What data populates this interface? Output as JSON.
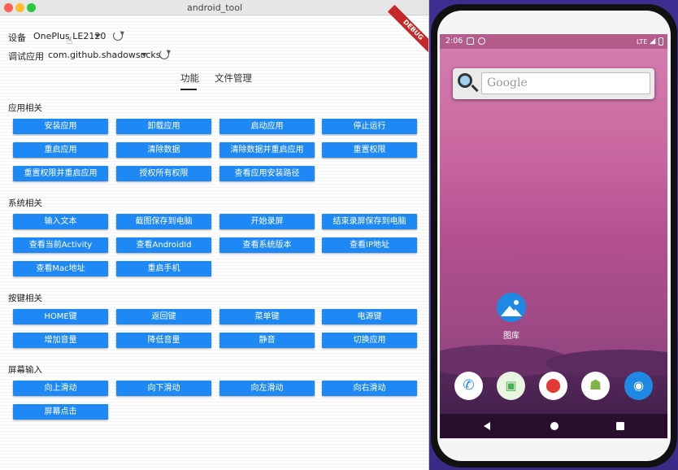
{
  "window": {
    "title": "android_tool",
    "debug_banner": "DEBUG"
  },
  "header": {
    "device_label": "设备",
    "device_value": "OnePlus LE2120",
    "app_label": "调试应用",
    "app_value": "com.github.shadowsocks"
  },
  "tabs": [
    {
      "label": "功能"
    },
    {
      "label": "文件管理"
    }
  ],
  "sections": [
    {
      "title": "应用相关",
      "buttons": [
        "安装应用",
        "卸载应用",
        "启动应用",
        "停止运行",
        "重启应用",
        "清除数据",
        "清除数据并重启应用",
        "重置权限",
        "重置权限并重启应用",
        "授权所有权限",
        "查看应用安装路径"
      ]
    },
    {
      "title": "系统相关",
      "buttons": [
        "输入文本",
        "截图保存到电脑",
        "开始录屏",
        "结束录屏保存到电脑",
        "查看当前Activity",
        "查看AndroidId",
        "查看系统版本",
        "查看IP地址",
        "查看Mac地址",
        "重启手机"
      ]
    },
    {
      "title": "按键相关",
      "buttons": [
        "HOME键",
        "返回键",
        "菜单键",
        "电源键",
        "增加音量",
        "降低音量",
        "静音",
        "切换应用"
      ]
    },
    {
      "title": "屏幕输入",
      "buttons": [
        "向上滑动",
        "向下滑动",
        "向左滑动",
        "向右滑动",
        "屏幕点击"
      ]
    }
  ],
  "phone": {
    "time": "2:06",
    "network": "LTE",
    "search_logo": "Google",
    "gallery_label": "图库",
    "dock_icons": [
      "phone-icon",
      "store-icon",
      "maps-icon",
      "android-app-icon",
      "camera-icon"
    ]
  },
  "colors": {
    "button": "#1e88f5",
    "debug": "#c62828",
    "accent_dark": "#222222"
  }
}
